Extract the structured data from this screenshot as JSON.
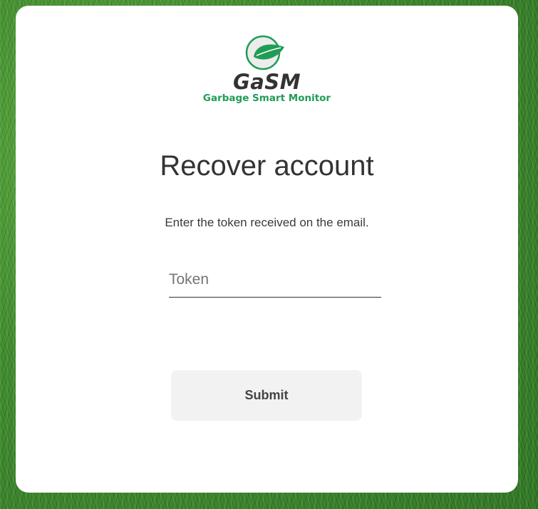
{
  "brand": {
    "name": "GaSM",
    "tagline": "Garbage Smart Monitor",
    "icon": "leaf-icon",
    "accent_color": "#1f9d55"
  },
  "recover": {
    "title": "Recover account",
    "instruction": "Enter the token received on the email.",
    "token_placeholder": "Token",
    "token_value": "",
    "submit_label": "Submit"
  }
}
